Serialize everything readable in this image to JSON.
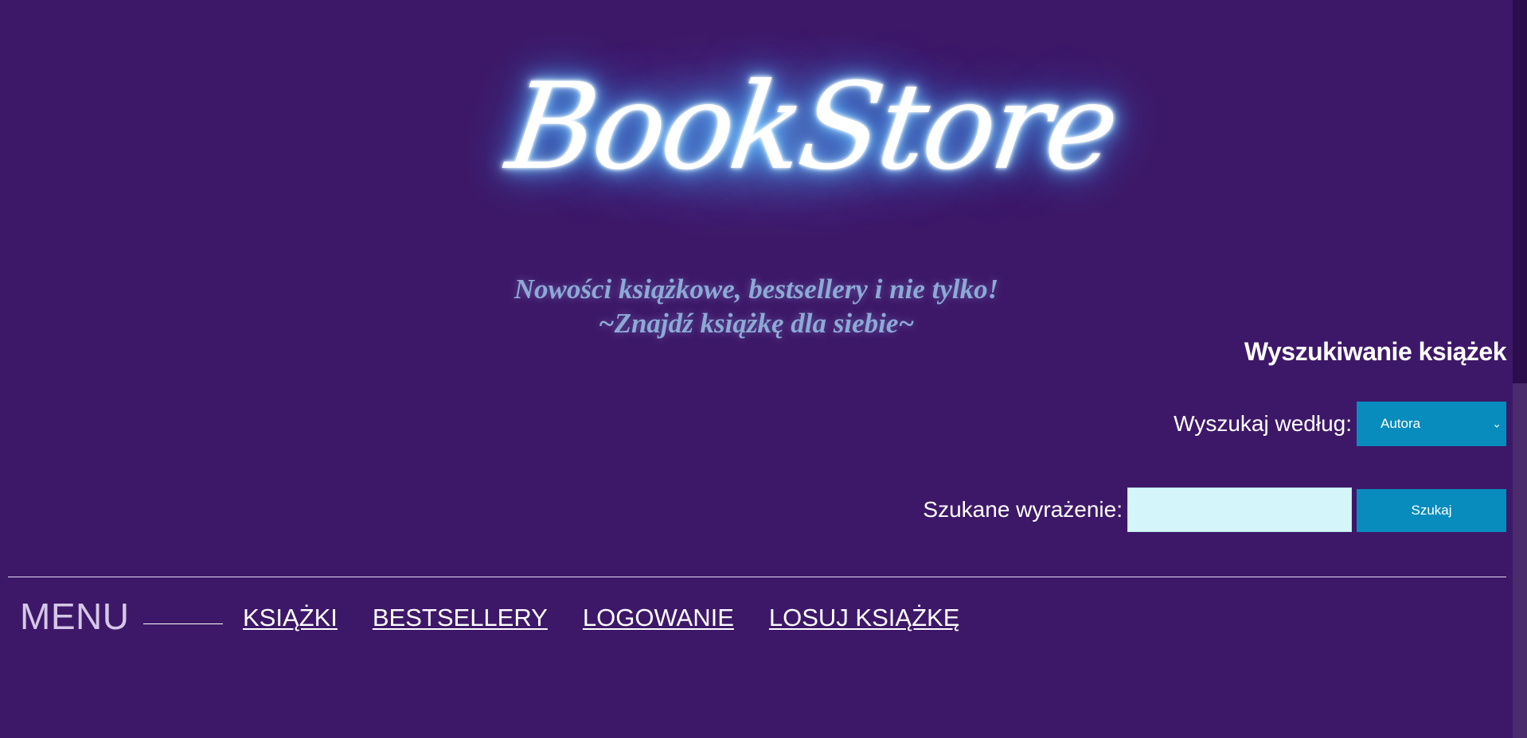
{
  "header": {
    "logo_text": "BookStore",
    "tagline_line1": "Nowości książkowe, bestsellery i nie tylko!",
    "tagline_line2": "~Znajdź książkę dla siebie~"
  },
  "search": {
    "title": "Wyszukiwanie książek",
    "by_label": "Wyszukaj według:",
    "by_selected": "Autora",
    "term_label": "Szukane wyrażenie:",
    "term_value": "",
    "button_label": "Szukaj"
  },
  "menu": {
    "title": "MENU",
    "links": [
      {
        "label": "KSIĄŻKI"
      },
      {
        "label": "BESTSELLERY"
      },
      {
        "label": "LOGOWANIE"
      },
      {
        "label": "LOSUJ KSIĄŻKĘ"
      }
    ]
  },
  "colors": {
    "background": "#3e1868",
    "accent": "#078cbd",
    "input_bg": "#d4f5fa",
    "tagline": "#8ea9d6"
  }
}
